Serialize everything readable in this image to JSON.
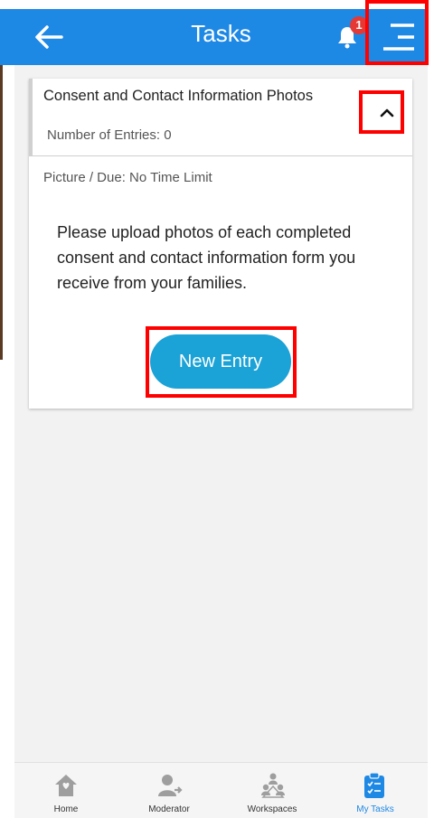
{
  "header": {
    "title": "Tasks",
    "notification_count": "1"
  },
  "card": {
    "title": "Consent and Contact Information Photos",
    "entries_text": "Number of Entries: 0",
    "meta_text": "Picture / Due: No Time Limit",
    "description": "Please upload photos of each completed consent and contact information form you receive from your families.",
    "new_entry_label": "New Entry"
  },
  "bottom_nav": {
    "items": [
      {
        "label": "Home",
        "icon": "home-icon",
        "active": false
      },
      {
        "label": "Moderator",
        "icon": "moderator-icon",
        "active": false
      },
      {
        "label": "Workspaces",
        "icon": "workspaces-icon",
        "active": false
      },
      {
        "label": "My Tasks",
        "icon": "clipboard-icon",
        "active": true
      }
    ]
  },
  "colors": {
    "primary": "#1e88e5",
    "button": "#1ba2d6",
    "badge": "#e53935",
    "highlight": "#ff0000"
  }
}
